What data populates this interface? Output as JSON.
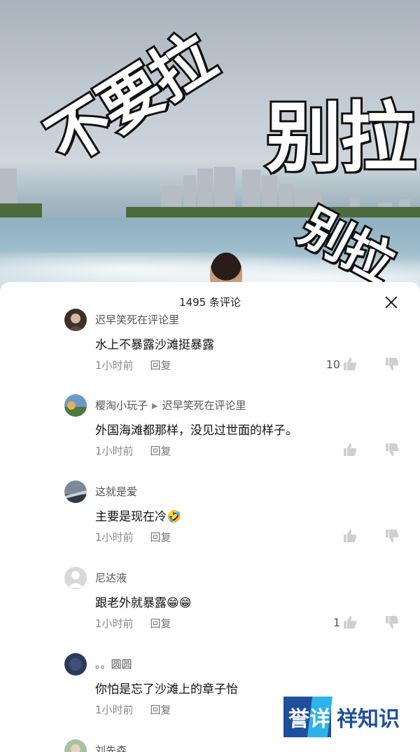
{
  "video": {
    "overlay_texts": [
      "不要拉",
      "别拉",
      "别拉"
    ]
  },
  "comments_panel": {
    "count_label": "1495 条评论",
    "close_icon": "close-icon"
  },
  "comments": [
    {
      "user": "迟早笑死在评论里",
      "reply_to": "",
      "text": "水上不暴露沙滩挺暴露",
      "time": "1小时前",
      "reply_label": "回复",
      "likes": "10"
    },
    {
      "user": "樱淘小玩子",
      "reply_to": "迟早笑死在评论里",
      "text": "外国海滩都那样，没见过世面的样子。",
      "time": "1小时前",
      "reply_label": "回复",
      "likes": ""
    },
    {
      "user": "这就是爱",
      "reply_to": "",
      "text": "主要是现在冷🤣",
      "time": "1小时前",
      "reply_label": "回复",
      "likes": ""
    },
    {
      "user": "尼达液",
      "reply_to": "",
      "text": "跟老外就暴露😁😁",
      "time": "1小时前",
      "reply_label": "回复",
      "likes": "1"
    },
    {
      "user": "。。圆圆",
      "reply_to": "",
      "text": "你怕是忘了沙滩上的章子怡",
      "time": "1小时前",
      "reply_label": "回复",
      "likes": ""
    },
    {
      "user": "刘先森",
      "reply_to": "",
      "text": "",
      "time": "",
      "reply_label": "",
      "likes": ""
    }
  ],
  "watermark": {
    "box1": "誉",
    "box2": "详",
    "text": "祥知识"
  }
}
